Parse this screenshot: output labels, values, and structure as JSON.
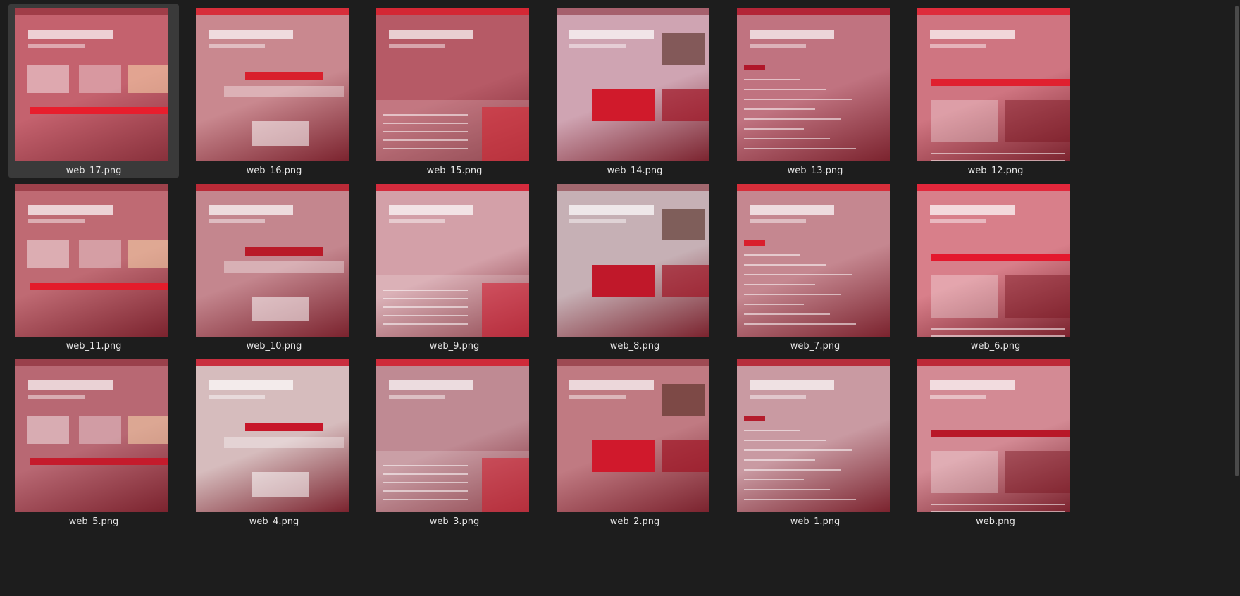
{
  "files": [
    {
      "name": "web_17.png",
      "selected": true,
      "bg": "#c4626e",
      "accent": "#e81e2d",
      "title": "",
      "variant": 0
    },
    {
      "name": "web_16.png",
      "selected": false,
      "bg": "#c9888f",
      "accent": "#d91f2c",
      "title": "",
      "variant": 1
    },
    {
      "name": "web_15.png",
      "selected": false,
      "bg": "#b65a66",
      "accent": "#d91f2c",
      "title": "",
      "variant": 2
    },
    {
      "name": "web_14.png",
      "selected": false,
      "bg": "#cfa4b2",
      "accent": "#d01a2b",
      "title": "",
      "variant": 3
    },
    {
      "name": "web_13.png",
      "selected": false,
      "bg": "#c07380",
      "accent": "#b0172a",
      "title": "",
      "variant": 4
    },
    {
      "name": "web_12.png",
      "selected": false,
      "bg": "#cf7581",
      "accent": "#e0202f",
      "title": "",
      "variant": 5
    },
    {
      "name": "web_11.png",
      "selected": false,
      "bg": "#bf6a73",
      "accent": "#e41c2b",
      "title": "",
      "variant": 6
    },
    {
      "name": "web_10.png",
      "selected": false,
      "bg": "#c4868e",
      "accent": "#b91a28",
      "title": "",
      "variant": 7
    },
    {
      "name": "web_9.png",
      "selected": false,
      "bg": "#d3a0a8",
      "accent": "#d3162a",
      "title": "",
      "variant": 8
    },
    {
      "name": "web_8.png",
      "selected": false,
      "bg": "#c6b0b5",
      "accent": "#c0182a",
      "title": "",
      "variant": 9
    },
    {
      "name": "web_7.png",
      "selected": false,
      "bg": "#c58790",
      "accent": "#d91f2c",
      "title": "",
      "variant": 10
    },
    {
      "name": "web_6.png",
      "selected": false,
      "bg": "#d87f8a",
      "accent": "#e4182d",
      "title": "",
      "variant": 11
    },
    {
      "name": "web_5.png",
      "selected": false,
      "bg": "#b86873",
      "accent": "#c51b2c",
      "title": "",
      "variant": 12
    },
    {
      "name": "web_4.png",
      "selected": false,
      "bg": "#d6bcbd",
      "accent": "#c71629",
      "title": "",
      "variant": 13
    },
    {
      "name": "web_3.png",
      "selected": false,
      "bg": "#bf8a93",
      "accent": "#d11a2a",
      "title": "",
      "variant": 14
    },
    {
      "name": "web_2.png",
      "selected": false,
      "bg": "#c07a82",
      "accent": "#d0192c",
      "title": "",
      "variant": 15
    },
    {
      "name": "web_1.png",
      "selected": false,
      "bg": "#c99aa2",
      "accent": "#b41c2c",
      "title": "",
      "variant": 16
    },
    {
      "name": "web.png",
      "selected": false,
      "bg": "#d38a94",
      "accent": "#b81828",
      "title": "",
      "variant": 17
    }
  ],
  "colors": {
    "background": "#1d1d1d",
    "selected_tile": "#3a3a3a",
    "label_text": "#e6e6e6"
  }
}
